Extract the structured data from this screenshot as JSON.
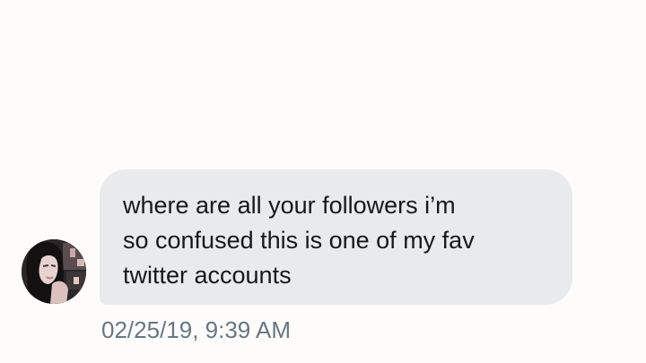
{
  "conversation": {
    "message": {
      "text": "where are all your followers i’m\nso confused this is one of my fav\ntwitter accounts",
      "timestamp": "02/25/19, 9:39 AM"
    },
    "sender": {
      "avatar_icon": "user-photo-avatar"
    }
  },
  "colors": {
    "background": "#fdfcfa",
    "bubble": "#e9eaec",
    "text": "#15181c",
    "timestamp": "#687684"
  }
}
